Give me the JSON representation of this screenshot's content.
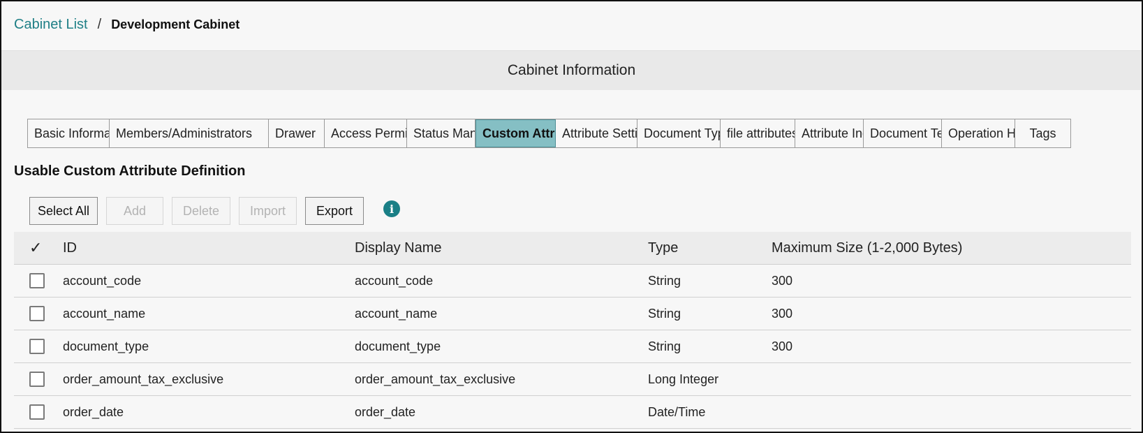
{
  "breadcrumb": {
    "link": "Cabinet List",
    "separator": "/",
    "current": "Development Cabinet"
  },
  "section_title": "Cabinet Information",
  "tabs": [
    {
      "label": "Basic Information",
      "active": false
    },
    {
      "label": "Members/Administrators",
      "active": false
    },
    {
      "label": "Drawer",
      "active": false
    },
    {
      "label": "Access Permissions",
      "active": false
    },
    {
      "label": "Status Management",
      "active": false
    },
    {
      "label": "Custom Attributes",
      "active": true
    },
    {
      "label": "Attribute Settings",
      "active": false
    },
    {
      "label": "Document Types",
      "active": false
    },
    {
      "label": "file attributes",
      "active": false
    },
    {
      "label": "Attribute Index",
      "active": false
    },
    {
      "label": "Document Templates",
      "active": false
    },
    {
      "label": "Operation History",
      "active": false
    },
    {
      "label": "Tags",
      "active": false
    }
  ],
  "definition_title": "Usable Custom Attribute Definition",
  "toolbar": {
    "select_all": "Select All",
    "add": "Add",
    "delete": "Delete",
    "import": "Import",
    "export": "Export",
    "info_icon": "i"
  },
  "table": {
    "check_header": "✓",
    "columns": {
      "id": "ID",
      "display_name": "Display Name",
      "type": "Type",
      "max_size": "Maximum Size (1-2,000 Bytes)"
    },
    "rows": [
      {
        "id": "account_code",
        "display_name": "account_code",
        "type": "String",
        "max_size": "300"
      },
      {
        "id": "account_name",
        "display_name": "account_name",
        "type": "String",
        "max_size": "300"
      },
      {
        "id": "document_type",
        "display_name": "document_type",
        "type": "String",
        "max_size": "300"
      },
      {
        "id": "order_amount_tax_exclusive",
        "display_name": "order_amount_tax_exclusive",
        "type": "Long Integer",
        "max_size": ""
      },
      {
        "id": "order_date",
        "display_name": "order_date",
        "type": "Date/Time",
        "max_size": ""
      }
    ]
  },
  "colors": {
    "link": "#1f7f86",
    "active_tab": "#85bfc4",
    "info_icon": "#1a7f86"
  }
}
